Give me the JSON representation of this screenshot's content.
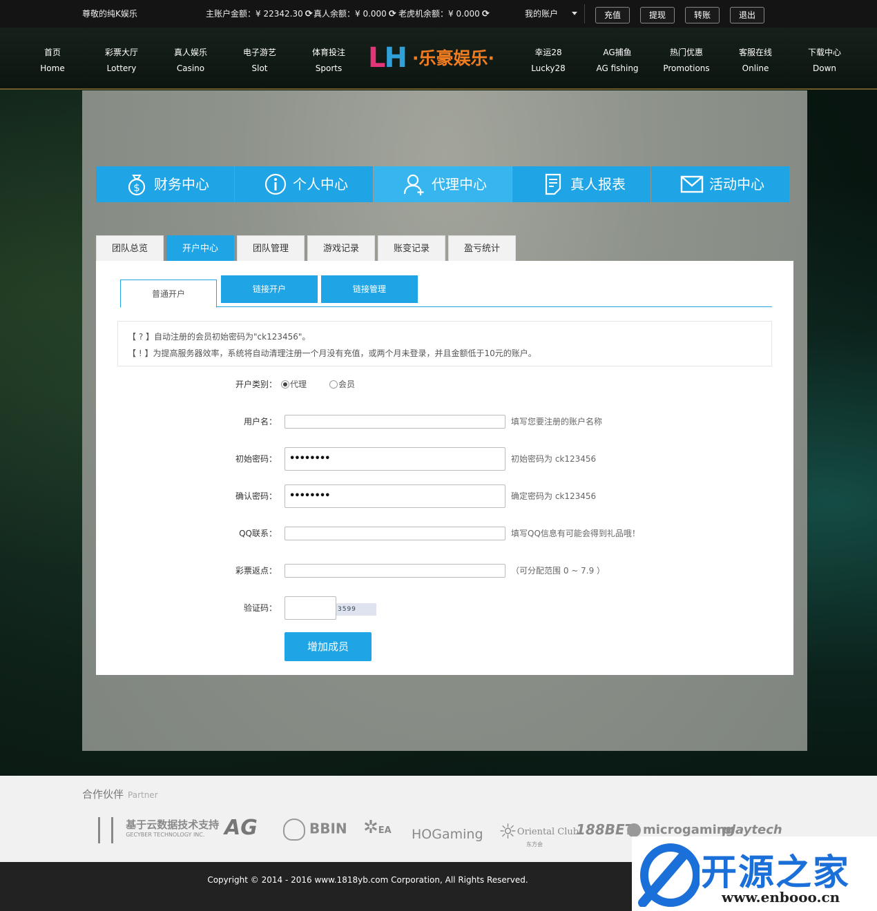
{
  "topbar": {
    "welcome": "尊敬的纯K娱乐",
    "main_balance": "主账户金额：¥ 22342.30",
    "live_balance": "真人余额：¥ 0.000",
    "slot_balance": "老虎机余额：¥ 0.000",
    "my_account": "我的账户",
    "buttons": [
      "充值",
      "提现",
      "转账",
      "退出"
    ]
  },
  "nav": {
    "items": [
      {
        "cn": "首页",
        "en": "Home"
      },
      {
        "cn": "彩票大厅",
        "en": "Lottery"
      },
      {
        "cn": "真人娱乐",
        "en": "Casino"
      },
      {
        "cn": "电子游艺",
        "en": "Slot"
      },
      {
        "cn": "体育投注",
        "en": "Sports"
      },
      {
        "cn": "幸运28",
        "en": "Lucky28"
      },
      {
        "cn": "AG捕鱼",
        "en": "AG fishing"
      },
      {
        "cn": "热门优惠",
        "en": "Promotions"
      },
      {
        "cn": "客服在线",
        "en": "Online"
      },
      {
        "cn": "下载中心",
        "en": "Down"
      }
    ],
    "logo_letters": "LH",
    "logo_text": "·乐豪娱乐·"
  },
  "main_tabs": [
    {
      "label": "财务中心",
      "icon": "money-bag-icon"
    },
    {
      "label": "个人中心",
      "icon": "info-icon"
    },
    {
      "label": "代理中心",
      "icon": "user-plus-icon"
    },
    {
      "label": "真人报表",
      "icon": "report-icon"
    },
    {
      "label": "活动中心",
      "icon": "mail-icon"
    }
  ],
  "sub_tabs": [
    "团队总览",
    "开户中心",
    "团队管理",
    "游戏记录",
    "账变记录",
    "盈亏统计"
  ],
  "inner_tabs": [
    "普通开户",
    "链接开户",
    "链接管理"
  ],
  "notice": {
    "line1": "【 ? 】自动注册的会员初始密码为\"ck123456\"。",
    "line2": "【 ! 】为提高服务器效率，系统将自动清理注册一个月没有充值，或两个月未登录，并且金额低于10元的账户。"
  },
  "form": {
    "type_label": "开户类别：",
    "type_options": [
      "代理",
      "会员"
    ],
    "selected_type": "代理",
    "username_label": "用户名：",
    "username_hint": "填写您要注册的账户名称",
    "password_label": "初始密码：",
    "password_value": "••••••••",
    "password_hint": "初始密码为 ck123456",
    "confirm_label": "确认密码：",
    "confirm_value": "••••••••",
    "confirm_hint": "确定密码为 ck123456",
    "qq_label": "QQ联系：",
    "qq_hint": "填写QQ信息有可能会得到礼品哦！",
    "rebate_label": "彩票返点：",
    "rebate_hint": "（可分配范围 0 ~ 7.9 ）",
    "captcha_label": "验证码：",
    "captcha_image_text": "3599",
    "submit_label": "增加成员"
  },
  "partners": {
    "title": "合作伙伴",
    "subtitle": "Partner",
    "logos": [
      "基于云数据技术支持",
      "GECYBER TECHNOLOGY INC.",
      "AG",
      "BBIN",
      "EA",
      "HOGaming",
      "Oriental Club",
      "东方会",
      "188BET",
      "microgaming",
      "playtech"
    ]
  },
  "footer": {
    "copyright": "Copyright © 2014 - 2016 www.1818yb.com Corporation, All Rights Reserved."
  },
  "watermark": {
    "title": "开源之家",
    "url": "www.enbooo.cn"
  },
  "colors": {
    "accent": "#1fa5e5",
    "topbar": "#141414",
    "footer": "#222222"
  }
}
